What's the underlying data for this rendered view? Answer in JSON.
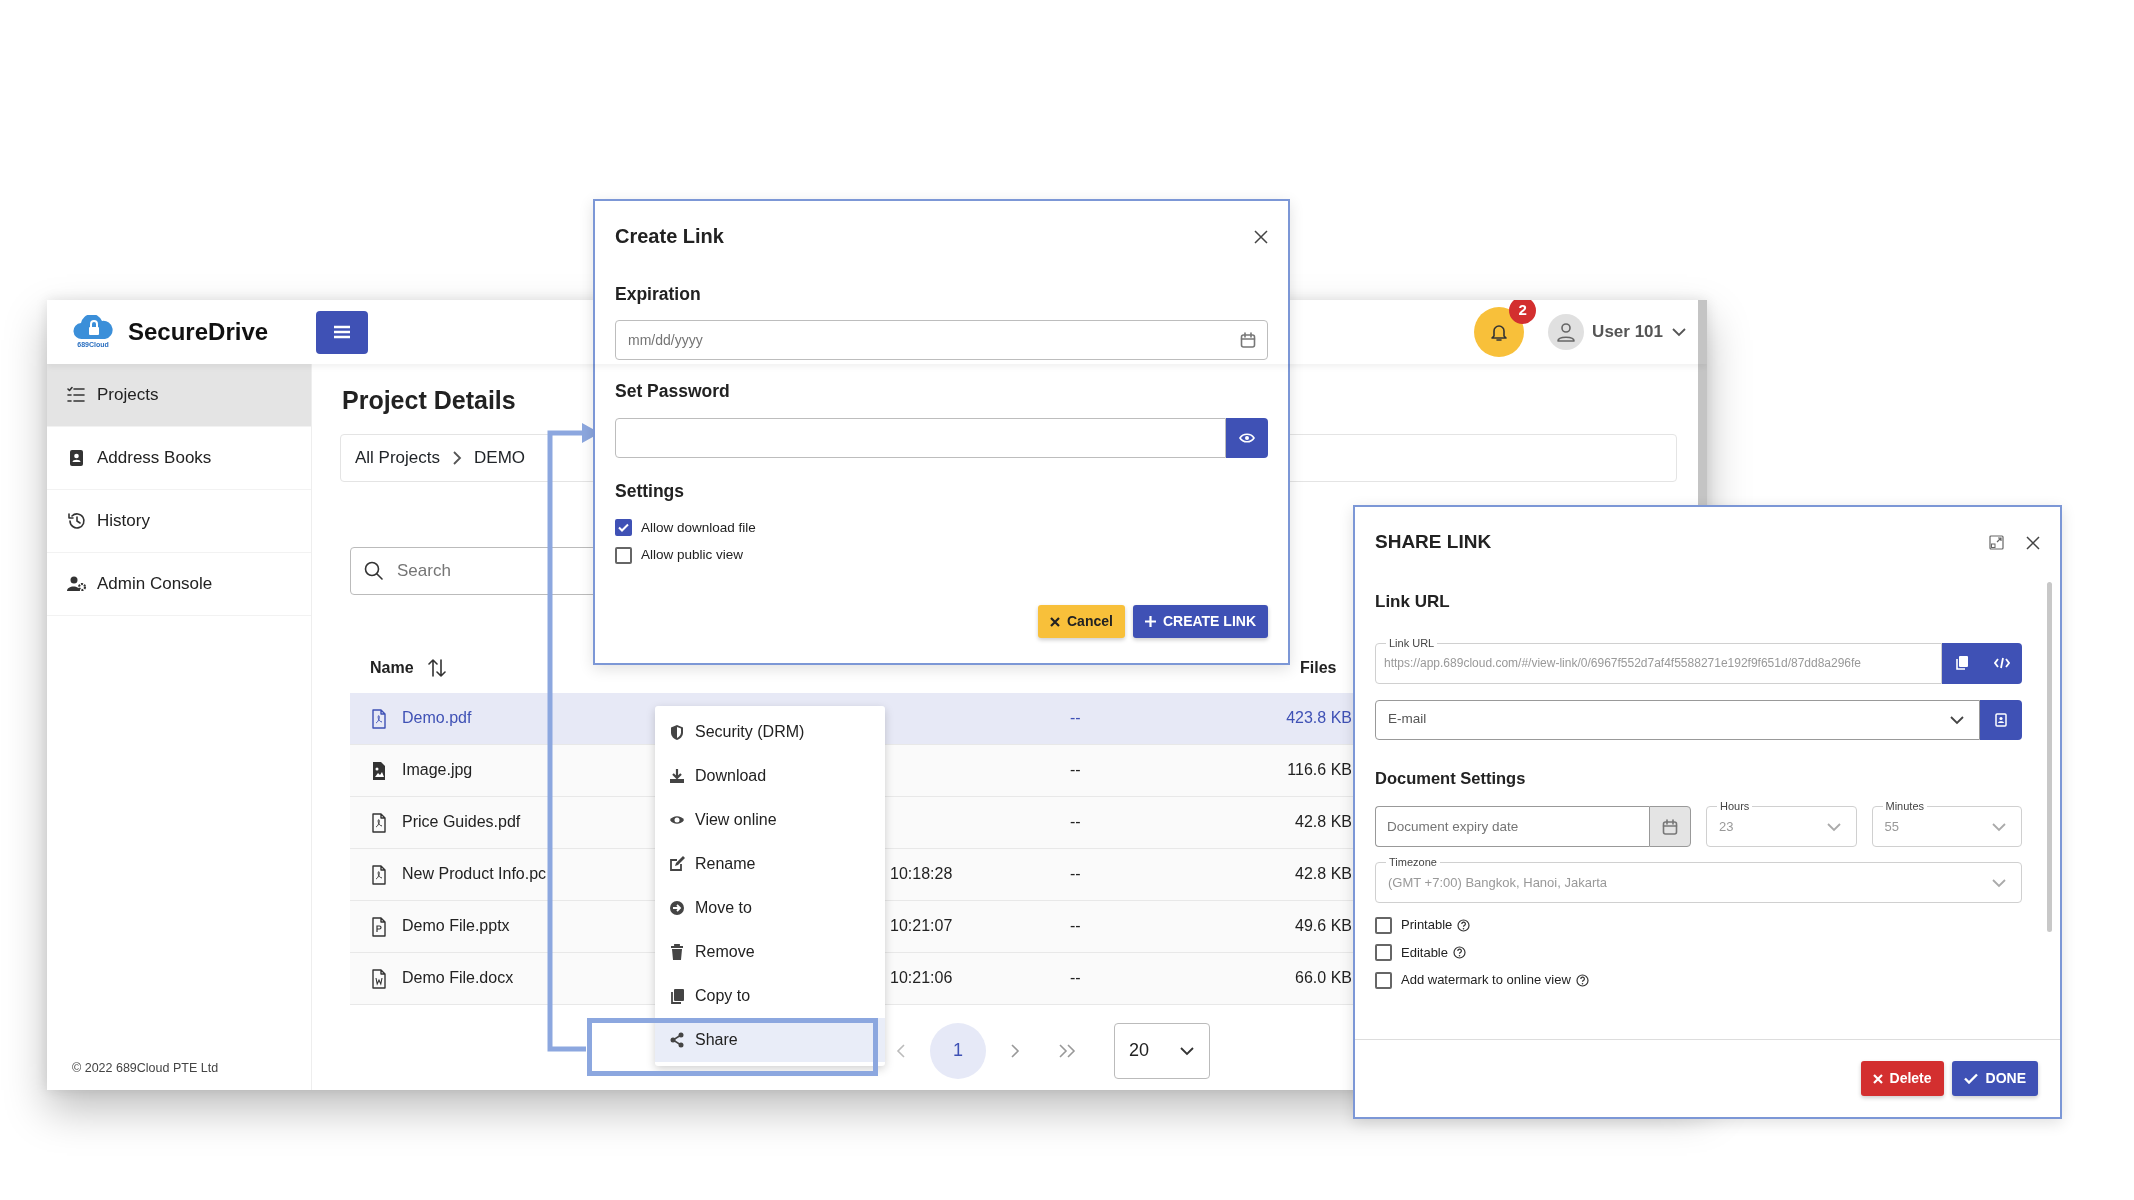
{
  "app": {
    "logo_caption": "689Cloud",
    "brand": "SecureDrive",
    "notifications": "2",
    "user": "User 101"
  },
  "sidebar": {
    "items": [
      {
        "label": "Projects",
        "selected": true
      },
      {
        "label": "Address Books",
        "selected": false
      },
      {
        "label": "History",
        "selected": false
      },
      {
        "label": "Admin Console",
        "selected": false
      }
    ],
    "footer": "© 2022 689Cloud PTE Ltd"
  },
  "page": {
    "title": "Project Details",
    "breadcrumb": [
      "All Projects",
      "DEMO"
    ],
    "search": {
      "placeholder": "Search"
    }
  },
  "table": {
    "columns": [
      "Name",
      "Files"
    ],
    "rows": [
      {
        "name": "Demo.pdf",
        "kind": "pdf",
        "permission": "--",
        "size": "423.8 KB",
        "selected": true
      },
      {
        "name": "Image.jpg",
        "kind": "image",
        "permission": "--",
        "size": "116.6 KB",
        "selected": false
      },
      {
        "name": "Price Guides.pdf",
        "kind": "pdf",
        "permission": "--",
        "size": "42.8 KB",
        "selected": false
      },
      {
        "name": "New Product Info.pc",
        "kind": "pdf",
        "date": "10:18:28",
        "permission": "--",
        "size": "42.8 KB",
        "selected": false
      },
      {
        "name": "Demo File.pptx",
        "kind": "pptx",
        "date": "10:21:07",
        "permission": "--",
        "size": "49.6 KB",
        "selected": false
      },
      {
        "name": "Demo File.docx",
        "kind": "docx",
        "date": "10:21:06",
        "permission": "--",
        "size": "66.0 KB",
        "selected": false
      }
    ]
  },
  "pagination": {
    "pages": [
      {
        "label": "1",
        "selected": true
      }
    ],
    "page_size": "20"
  },
  "context_menu": {
    "items": [
      {
        "label": "Security (DRM)",
        "selected": false
      },
      {
        "label": "Download",
        "selected": false
      },
      {
        "label": "View online",
        "selected": false
      },
      {
        "label": "Rename",
        "selected": false
      },
      {
        "label": "Move to",
        "selected": false
      },
      {
        "label": "Remove",
        "selected": false
      },
      {
        "label": "Copy to",
        "selected": false
      },
      {
        "label": "Share",
        "selected": true
      }
    ]
  },
  "create_link": {
    "title": "Create Link",
    "expiration_label": "Expiration",
    "date_placeholder": "mm/dd/yyyy",
    "password_label": "Set Password",
    "settings_label": "Settings",
    "options": [
      {
        "label": "Allow download file",
        "checked": true
      },
      {
        "label": "Allow public view",
        "checked": false
      }
    ],
    "cancel": "Cancel",
    "create": "CREATE LINK"
  },
  "share_link": {
    "title": "SHARE LINK",
    "link_heading": "Link URL",
    "url_label": "Link URL",
    "url": "https://app.689cloud.com/#/view-link/0/6967f552d7af4f5588271e192f9f651d/87dd8a296fe",
    "email_placeholder": "E-mail",
    "settings_heading": "Document Settings",
    "expiry_placeholder": "Document expiry date",
    "hours": {
      "label": "Hours",
      "value": "23",
      "disabled": true
    },
    "minutes": {
      "label": "Minutes",
      "value": "55",
      "disabled": true
    },
    "timezone": {
      "label": "Timezone",
      "value": "(GMT +7:00) Bangkok, Hanoi, Jakarta",
      "disabled": true
    },
    "options": [
      {
        "label": "Printable",
        "checked": false
      },
      {
        "label": "Editable",
        "checked": false
      },
      {
        "label": "Add watermark to online view",
        "checked": false
      }
    ],
    "delete": "Delete",
    "done": "DONE"
  }
}
